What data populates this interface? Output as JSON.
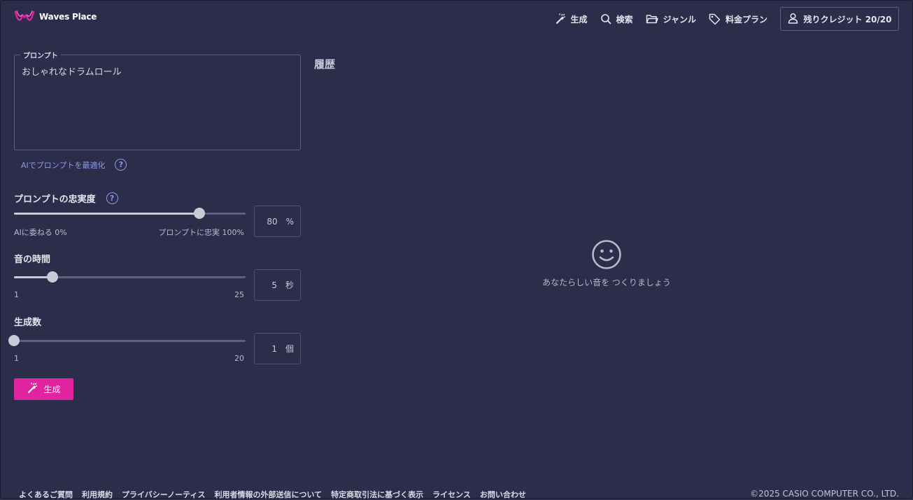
{
  "colors": {
    "background": "#2b2d4b",
    "accent": "#e0239e",
    "link": "#8f9be8",
    "border": "#5a5d7c"
  },
  "brand": {
    "name": "Waves Place",
    "icon": "waves-place-logo"
  },
  "nav": {
    "items": [
      {
        "label": "生成",
        "icon": "magic-wand-icon"
      },
      {
        "label": "検索",
        "icon": "search-icon"
      },
      {
        "label": "ジャンル",
        "icon": "folder-icon"
      },
      {
        "label": "料金プラン",
        "icon": "tag-icon"
      }
    ],
    "credits": {
      "label": "残りクレジット 20/20",
      "icon": "user-icon"
    }
  },
  "prompt": {
    "legend": "プロンプト",
    "value": "おしゃれなドラムロール",
    "optimize_link": "AIでプロンプトを最適化",
    "help_glyph": "?"
  },
  "fidelity": {
    "label": "プロンプトの忠実度",
    "help_glyph": "?",
    "min_label": "AIに委ねる 0%",
    "max_label": "プロンプトに忠実 100%",
    "min": 0,
    "max": 100,
    "value": 80,
    "display_value": "80",
    "unit": "%"
  },
  "duration": {
    "label": "音の時間",
    "min_label": "1",
    "max_label": "25",
    "min": 1,
    "max": 25,
    "value": 5,
    "display_value": "5",
    "unit": "秒"
  },
  "count": {
    "label": "生成数",
    "min_label": "1",
    "max_label": "20",
    "min": 1,
    "max": 20,
    "value": 1,
    "display_value": "1",
    "unit": "個"
  },
  "generate_button": {
    "label": "生成",
    "icon": "magic-wand-icon"
  },
  "history": {
    "title": "履歴",
    "empty_icon": "smiley-icon",
    "empty_message": "あなたらしい音を つくりましょう"
  },
  "footer": {
    "links": [
      "よくあるご質問",
      "利用規約",
      "プライバシーノーティス",
      "利用者情報の外部送信について",
      "特定商取引法に基づく表示",
      "ライセンス",
      "お問い合わせ"
    ],
    "copyright": "©2025 CASIO COMPUTER CO., LTD."
  }
}
